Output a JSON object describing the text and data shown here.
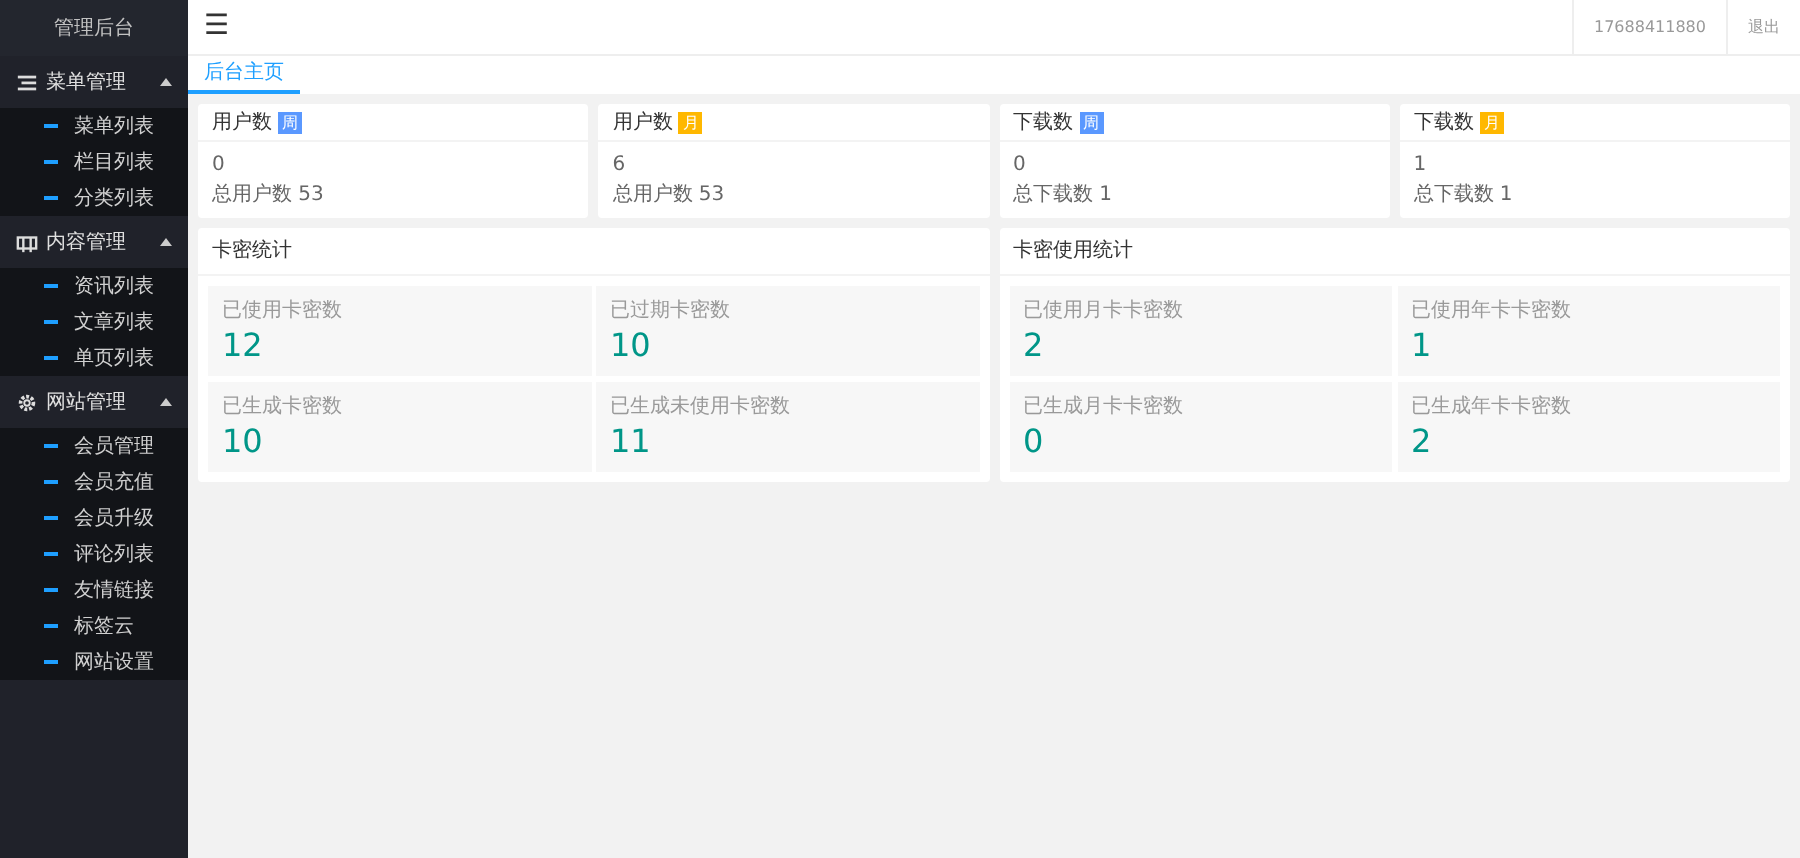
{
  "sidebar": {
    "title": "管理后台",
    "groups": [
      {
        "label": "菜单管理",
        "kind": "menu",
        "expanded": true,
        "items": [
          "菜单列表",
          "栏目列表",
          "分类列表"
        ]
      },
      {
        "label": "内容管理",
        "kind": "content",
        "expanded": true,
        "items": [
          "资讯列表",
          "文章列表",
          "单页列表"
        ]
      },
      {
        "label": "网站管理",
        "kind": "gear",
        "expanded": true,
        "items": [
          "会员管理",
          "会员充值",
          "会员升级",
          "评论列表",
          "友情链接",
          "标签云",
          "网站设置"
        ]
      }
    ]
  },
  "header": {
    "menu_toggle": "☰",
    "user": "17688411880",
    "logout": "退出"
  },
  "tabs": [
    {
      "label": "后台主页",
      "selected": true
    }
  ],
  "summary_cards": [
    {
      "title": "用户数",
      "badge": "周",
      "color": "#5a98ff",
      "value": "0",
      "total": "总用户数 53"
    },
    {
      "title": "用户数",
      "badge": "月",
      "color": "#ffb800",
      "value": "6",
      "total": "总用户数 53"
    },
    {
      "title": "下载数",
      "badge": "周",
      "color": "#5a98ff",
      "value": "0",
      "total": "总下载数 1"
    },
    {
      "title": "下载数",
      "badge": "月",
      "color": "#ffb800",
      "value": "1",
      "total": "总下载数 1"
    }
  ],
  "panels": [
    {
      "title": "卡密统计",
      "stats": [
        {
          "label": "已使用卡密数",
          "value": "12"
        },
        {
          "label": "已过期卡密数",
          "value": "10"
        },
        {
          "label": "已生成卡密数",
          "value": "10"
        },
        {
          "label": "已生成未使用卡密数",
          "value": "11"
        }
      ]
    },
    {
      "title": "卡密使用统计",
      "stats": [
        {
          "label": "已使用月卡卡密数",
          "value": "2"
        },
        {
          "label": "已使用年卡卡密数",
          "value": "1"
        },
        {
          "label": "已生成月卡卡密数",
          "value": "0"
        },
        {
          "label": "已生成年卡卡密数",
          "value": "2"
        }
      ]
    }
  ]
}
